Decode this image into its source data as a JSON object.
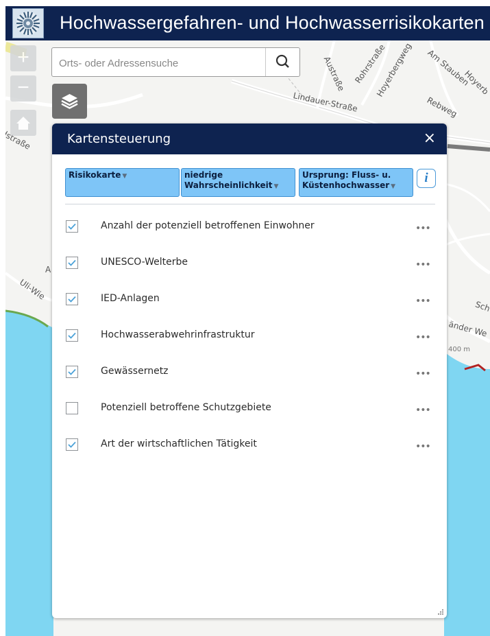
{
  "header": {
    "title": "Hochwassergefahren- und Hochwasserrisikokarten",
    "logo_icon": "logo-icon"
  },
  "map_controls": {
    "zoom_in": "+",
    "zoom_out": "−",
    "home_icon": "home-icon",
    "layers_icon": "layers-icon"
  },
  "search": {
    "placeholder": "Orts- oder Adressensuche",
    "value": "",
    "button_icon": "search-icon"
  },
  "map": {
    "street_labels": [
      "Austraße",
      "Rohrstraße",
      "Hoyerbergweg",
      "Am Stauben",
      "Hoyerb",
      "Lindauer-Straße",
      "Rebweg",
      "dstraße",
      "Uli-Wie",
      "A",
      "Sch",
      "änder We",
      "400 m"
    ],
    "water_color": "#7fd6f2",
    "land_color": "#f4f4f2"
  },
  "panel": {
    "title": "Kartensteuerung",
    "close_label": "×",
    "filters": [
      {
        "line1": "Risikokarte",
        "line2": ""
      },
      {
        "line1": "niedrige",
        "line2": "Wahrscheinlichkeit"
      },
      {
        "line1": "Ursprung: Fluss- u.",
        "line2": "Küstenhochwasser"
      }
    ],
    "info_label": "i",
    "more_label": "•••",
    "layers": [
      {
        "label": "Anzahl der potenziell betroffenen Einwohner",
        "checked": true
      },
      {
        "label": "UNESCO-Welterbe",
        "checked": true
      },
      {
        "label": "IED-Anlagen",
        "checked": true
      },
      {
        "label": "Hochwasserabwehrinfrastruktur",
        "checked": true
      },
      {
        "label": "Gewässernetz",
        "checked": true
      },
      {
        "label": "Potenziell betroffene Schutzgebiete",
        "checked": false
      },
      {
        "label": "Art der wirtschaftlichen Tätigkeit",
        "checked": true
      }
    ],
    "accent_color": "#0e2350",
    "filter_color": "#7ec5f7"
  }
}
